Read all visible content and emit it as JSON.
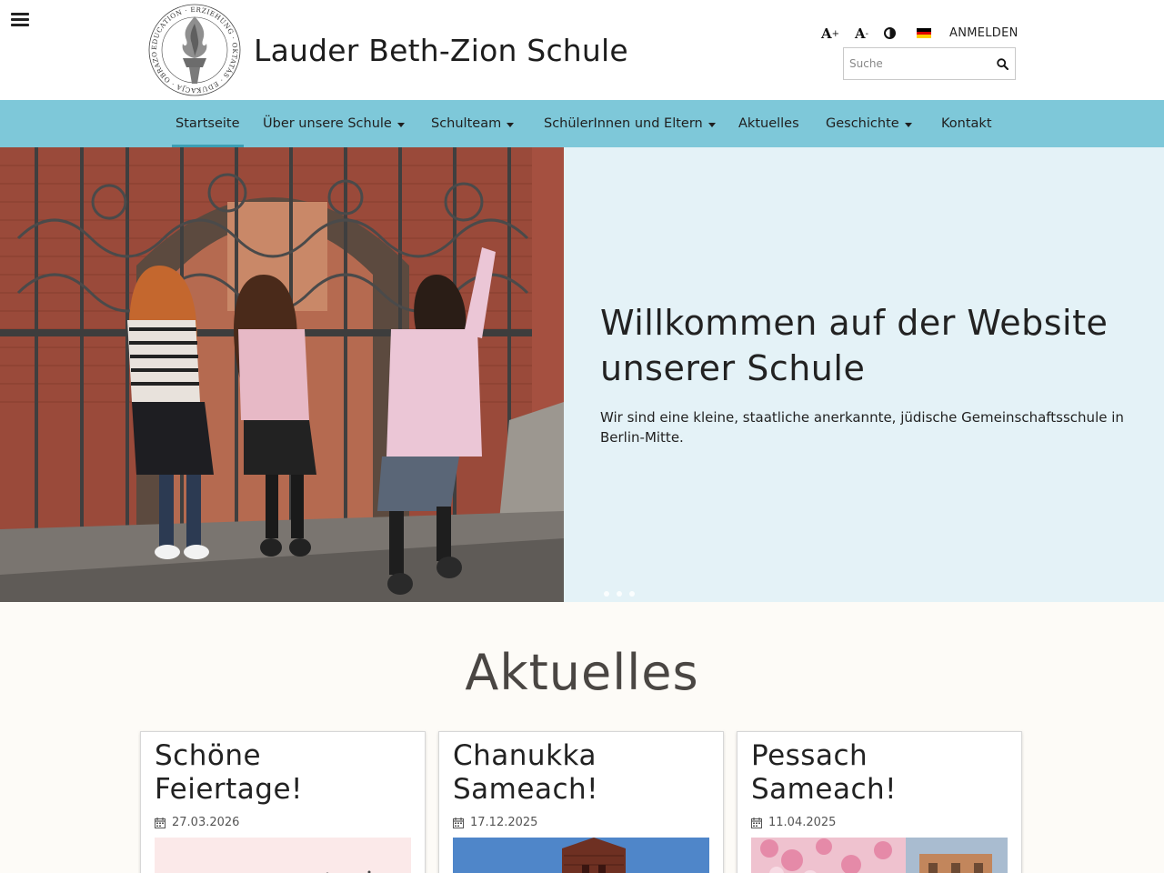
{
  "header": {
    "menu_icon": "hamburger-menu-icon",
    "logo_icon": "school-torch-logo",
    "logo_ring_text": "EDUCATION · ERZIEHUNG · OKTATÁS · EDUKACJA · OBRAZOVANIE",
    "site_title": "Lauder Beth-Zion Schule",
    "font_increase_label": "A",
    "font_increase_suffix": "+",
    "font_decrease_label": "A",
    "font_decrease_suffix": "-",
    "contrast_icon": "contrast-icon",
    "language_icon": "german-flag-icon",
    "login_label": "ANMELDEN",
    "search_placeholder": "Suche",
    "search_icon": "search-icon"
  },
  "nav": {
    "items": [
      {
        "label": "Startseite",
        "active": true
      },
      {
        "label": "Über unsere Schule"
      },
      {
        "label": "Schulteam"
      },
      {
        "label": "SchülerInnen und Eltern"
      },
      {
        "label": "Aktuelles"
      },
      {
        "label": "Geschichte"
      },
      {
        "label": "Kontakt"
      }
    ]
  },
  "hero": {
    "title": "Willkommen auf der Website unserer Schule",
    "text": "Wir sind eine kleine, staatliche anerkannte, jüdische Gemeinschaftsschule in Berlin-Mitte.",
    "slide_count": 3
  },
  "news": {
    "heading": "Aktuelles",
    "cards": [
      {
        "title": "Schöne Feiertage!",
        "date": "27.03.2026"
      },
      {
        "title": "Chanukka Sameach!",
        "date": "17.12.2025"
      },
      {
        "title": "Pessach Sameach!",
        "date": "11.04.2025"
      }
    ]
  },
  "colors": {
    "nav_bg": "#7ec8d9",
    "hero_panel_bg": "#e4f2f7",
    "page_bg": "#fdfbf7"
  }
}
